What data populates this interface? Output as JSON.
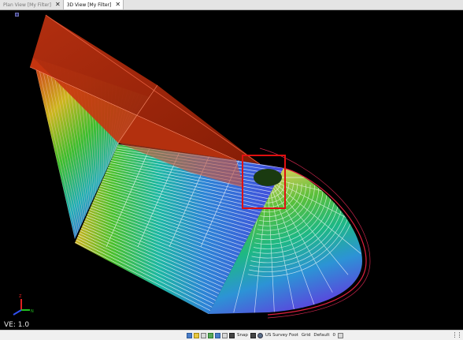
{
  "tabs": [
    {
      "label": "Plan View [My Filter]",
      "active": false
    },
    {
      "label": "3D View [My Filter]",
      "active": true
    }
  ],
  "viewport": {
    "ve_label": "VE: 1.0",
    "axis_labels": {
      "z": "Z",
      "n": "N"
    }
  },
  "statusbar": {
    "icons": [
      "view-icon",
      "layer-icon",
      "zoom-icon",
      "select-icon",
      "image-icon",
      "ruler-icon"
    ],
    "items": [
      {
        "label": "Snap",
        "icon": "snap-icon"
      },
      {
        "label": "US Survey Foot",
        "icon": "globe-icon"
      },
      {
        "label": "Grid",
        "icon": ""
      },
      {
        "label": "Default",
        "icon": ""
      },
      {
        "label": "0",
        "icon": "lock-icon"
      }
    ]
  },
  "colors": {
    "highlight": "#e01010",
    "roof": "#b22a0a",
    "background": "#000000"
  }
}
